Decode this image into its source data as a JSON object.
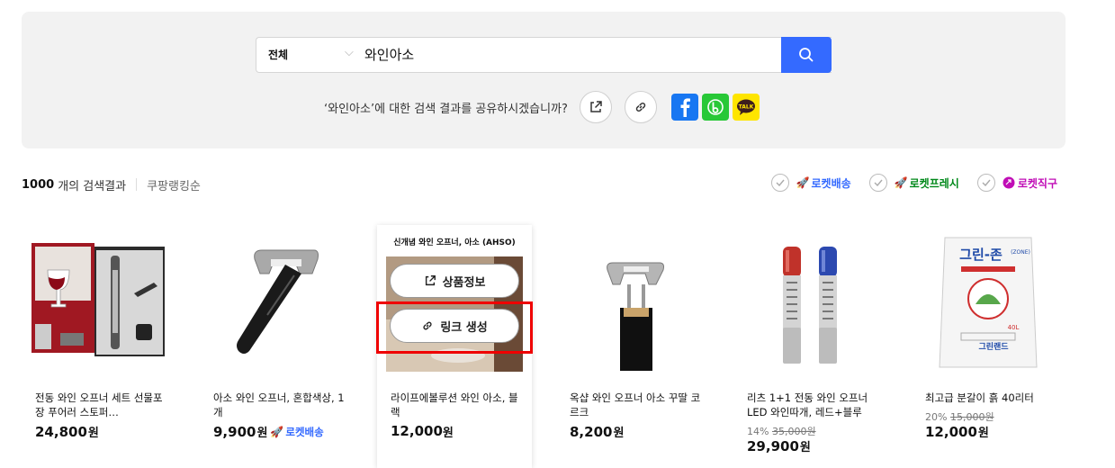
{
  "search": {
    "scope": "전체",
    "query": "와인아소"
  },
  "share": {
    "prompt": "‘와인아소’에 대한 검색 결과를 공유하시겠습니까?"
  },
  "results": {
    "count": "1000",
    "count_label": "개의 검색결과",
    "sort": "쿠팡랭킹순"
  },
  "filters": [
    {
      "label": "로켓배송",
      "color": "#346aff",
      "icon": "rocket-icon"
    },
    {
      "label": "로켓프레시",
      "color": "#00891a",
      "icon": "rocket-fresh-icon"
    },
    {
      "label": "로켓직구",
      "color": "#c00db6",
      "icon": "rocket-global-icon"
    }
  ],
  "products": [
    {
      "name": "전동 와인 오프너 세트 선물포장 푸어러 스토퍼…",
      "price": "24,800",
      "unit": "원"
    },
    {
      "name": "아소 와인 오프너, 혼합색상, 1개",
      "price": "9,900",
      "unit": "원",
      "badge": "로켓배송"
    },
    {
      "name": "라이프에볼루션 와인 아소, 블랙",
      "price": "12,000",
      "unit": "원"
    },
    {
      "name": "옥샵 와인 오프너 아소 꾸딸 코르크",
      "price": "8,200",
      "unit": "원"
    },
    {
      "name": "리츠 1+1 전동 와인 오프너 LED 와인따개, 레드+블루",
      "discount": "14%",
      "original": "35,000원",
      "price": "29,900",
      "unit": "원"
    },
    {
      "name": "최고급 분갈이 흙 40리터",
      "discount": "20%",
      "original": "15,000원",
      "price": "12,000",
      "unit": "원"
    }
  ],
  "hover": {
    "title": "신개념 와인 오프너, 아소 (AHSO)",
    "info_button": "상품정보",
    "link_button": "링크 생성"
  },
  "soil_bag": {
    "brand": "그린-존",
    "zone": "(ZONE)",
    "volume": "40L",
    "maker": "그린랜드"
  },
  "colors": {
    "accent": "#346aff",
    "highlight": "#ef0000"
  }
}
